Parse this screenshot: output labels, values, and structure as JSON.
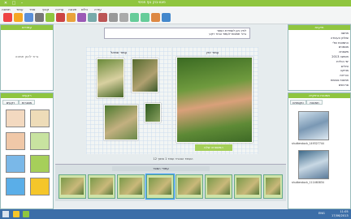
{
  "app": {
    "title": "פוטו-בוק נוף פנימי",
    "win_min": "–",
    "win_max": "□",
    "win_close": "✕"
  },
  "menu": [
    {
      "label": "עזרה"
    },
    {
      "label": "כלים"
    },
    {
      "label": "תצוגה"
    },
    {
      "label": "עריכה"
    },
    {
      "label": "קובץ"
    },
    {
      "label": "ספר"
    },
    {
      "label": "עמוד"
    },
    {
      "label": "תמונה"
    }
  ],
  "left_panel": {
    "top_header": "עמודים",
    "top_text": "גרור לכאן תמונה",
    "bottom_header": "רקעים",
    "tabs": [
      "רקעים",
      "מסגרות"
    ]
  },
  "canvas": {
    "top_message_line1": "לחץ כאן לשמירת הספר",
    "top_message_line2": "גרור תמונות לעמוד ובחר רקע",
    "left_page_title": "עמוד שמאל",
    "right_page_title": "עמוד ימין",
    "right_page_caption": "המשפחה שלנו",
    "bottom_status": "העמוד הנוכחי: עמוד 1 מתוך 12"
  },
  "filmstrip": {
    "label": "עמודי הספר",
    "page_count": 10,
    "selected_index": 4
  },
  "right_panel": {
    "top_header": "תיקיות",
    "tree_items": [
      {
        "label": "מחשב"
      },
      {
        "label": "שולחן העבודה"
      },
      {
        "label": "התמונות שלי"
      },
      {
        "label": "מסמכים"
      },
      {
        "label": "משפחה"
      },
      {
        "label": "חופשה 2013"
      },
      {
        "label": "ימי הולדת"
      },
      {
        "label": "טיולים"
      },
      {
        "label": "מוזיקה"
      },
      {
        "label": "הורדות"
      },
      {
        "label": "תמונות נוספות"
      },
      {
        "label": "סרטונים"
      }
    ],
    "bottom_header": "תמונות בתיקייה",
    "tabs": [
      "תמונות",
      "טקסטים"
    ],
    "thumbs": [
      {
        "label": "shutterstock_149327744"
      },
      {
        "label": "shutterstock_111460834"
      }
    ]
  },
  "taskbar": {
    "time": "11:05",
    "date": "17/06/2013",
    "lang": "ENG"
  },
  "colors": {
    "accent": "#8fc53f",
    "taskbar": "#3c6ea8",
    "window_bg": "#e9eef0"
  }
}
